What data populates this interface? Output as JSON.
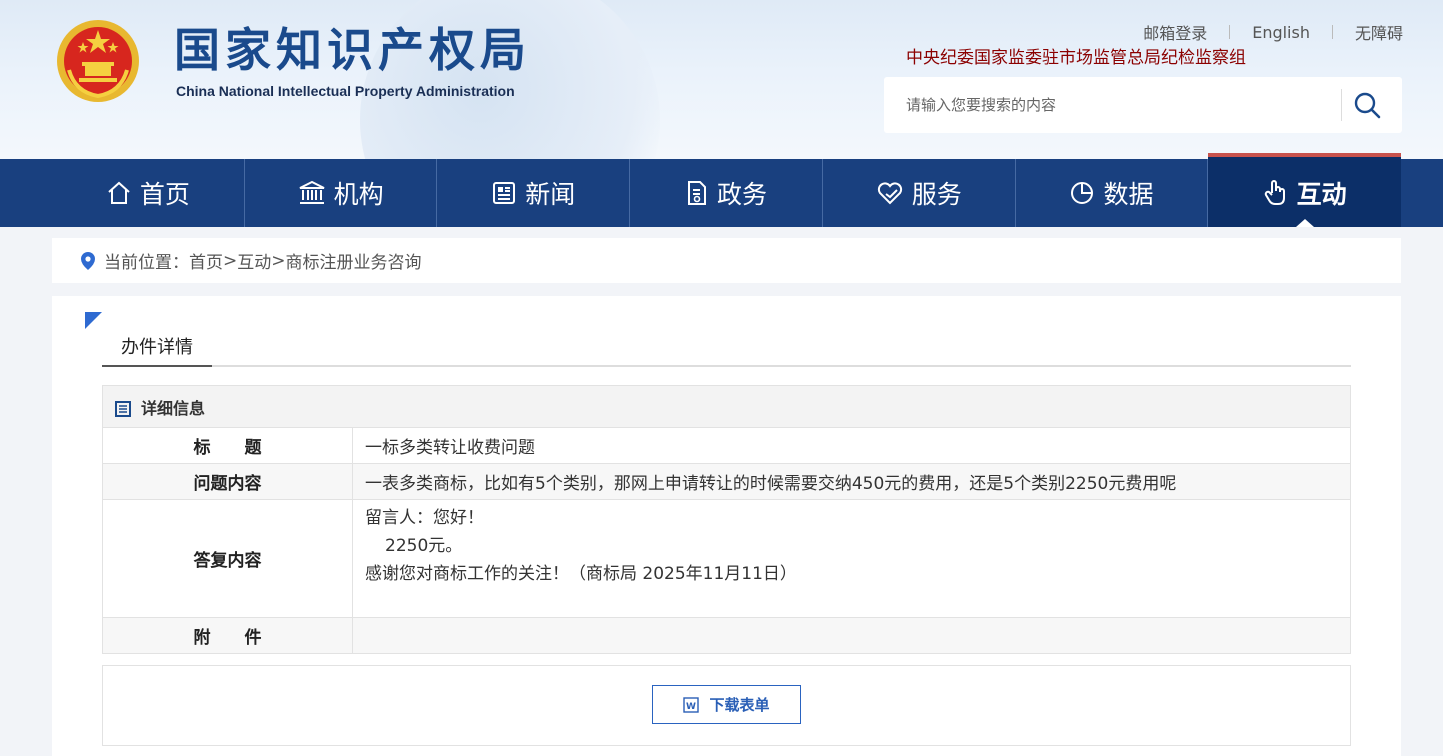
{
  "site": {
    "title_cn": "国家知识产权局",
    "title_en": "China National Intellectual Property Administration",
    "inspection": "中央纪委国家监委驻市场监管总局纪检监察组"
  },
  "top_links": [
    "邮箱登录",
    "English",
    "无障碍"
  ],
  "search": {
    "placeholder": "请输入您要搜索的内容"
  },
  "nav": [
    {
      "label": "首页",
      "icon": "home-icon"
    },
    {
      "label": "机构",
      "icon": "institution-icon"
    },
    {
      "label": "新闻",
      "icon": "news-icon"
    },
    {
      "label": "政务",
      "icon": "document-icon"
    },
    {
      "label": "服务",
      "icon": "service-icon"
    },
    {
      "label": "数据",
      "icon": "pie-chart-icon"
    },
    {
      "label": "互动",
      "icon": "touch-icon",
      "active": true
    }
  ],
  "breadcrumb": {
    "prefix": "当前位置：",
    "items": [
      "首页",
      "互动",
      "商标注册业务咨询"
    ],
    "separator": ">"
  },
  "main": {
    "tab_title": "办件详情",
    "section_title": "详细信息",
    "rows": [
      {
        "label": "标　　题",
        "value": "一标多类转让收费问题"
      },
      {
        "label": "问题内容",
        "value": "一表多类商标，比如有5个类别，那网上申请转让的时候需要交纳450元的费用，还是5个类别2250元费用呢"
      },
      {
        "label": "答复内容",
        "lines": [
          "留言人：您好！",
          "2250元。",
          "感谢您对商标工作的关注！（商标局 2025年11月11日）"
        ]
      },
      {
        "label": "附　　件",
        "value": ""
      }
    ],
    "download_label": "下载表单"
  },
  "colors": {
    "nav_bg": "#19407f",
    "nav_active": "#0c2f68",
    "accent": "#2e6ad1",
    "title_blue": "#1a4a8c",
    "inspection_red": "#8b0000"
  }
}
